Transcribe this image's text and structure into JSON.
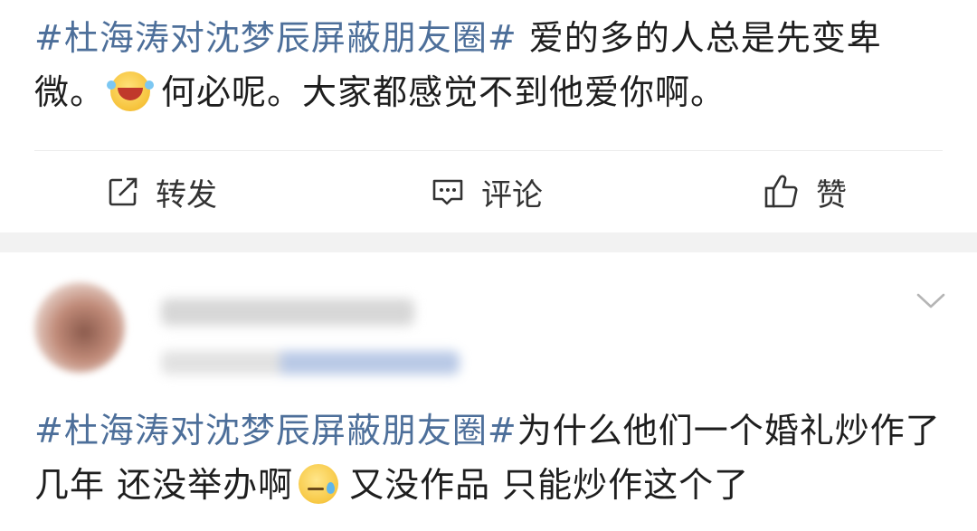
{
  "post1": {
    "topic": "#杜海涛对沈梦辰屏蔽朋友圈#",
    "text_a": " 爱的多的人总是先变卑微。",
    "emoji": "laughing-tears-emoji",
    "text_b": "何必呢。大家都感觉不到他爱你啊。"
  },
  "actions": {
    "repost_label": "转发",
    "comment_label": "评论",
    "like_label": "赞"
  },
  "post2": {
    "topic": "#杜海涛对沈梦辰屏蔽朋友圈#",
    "text_a": "为什么他们一个婚礼炒作了几年 还没举办啊",
    "emoji": "sweat-emoji",
    "text_b": "又没作品 只能炒作这个了"
  },
  "colors": {
    "topic": "#4d6f9a",
    "text": "#1e1e1e",
    "separator": "#f2f2f2"
  }
}
